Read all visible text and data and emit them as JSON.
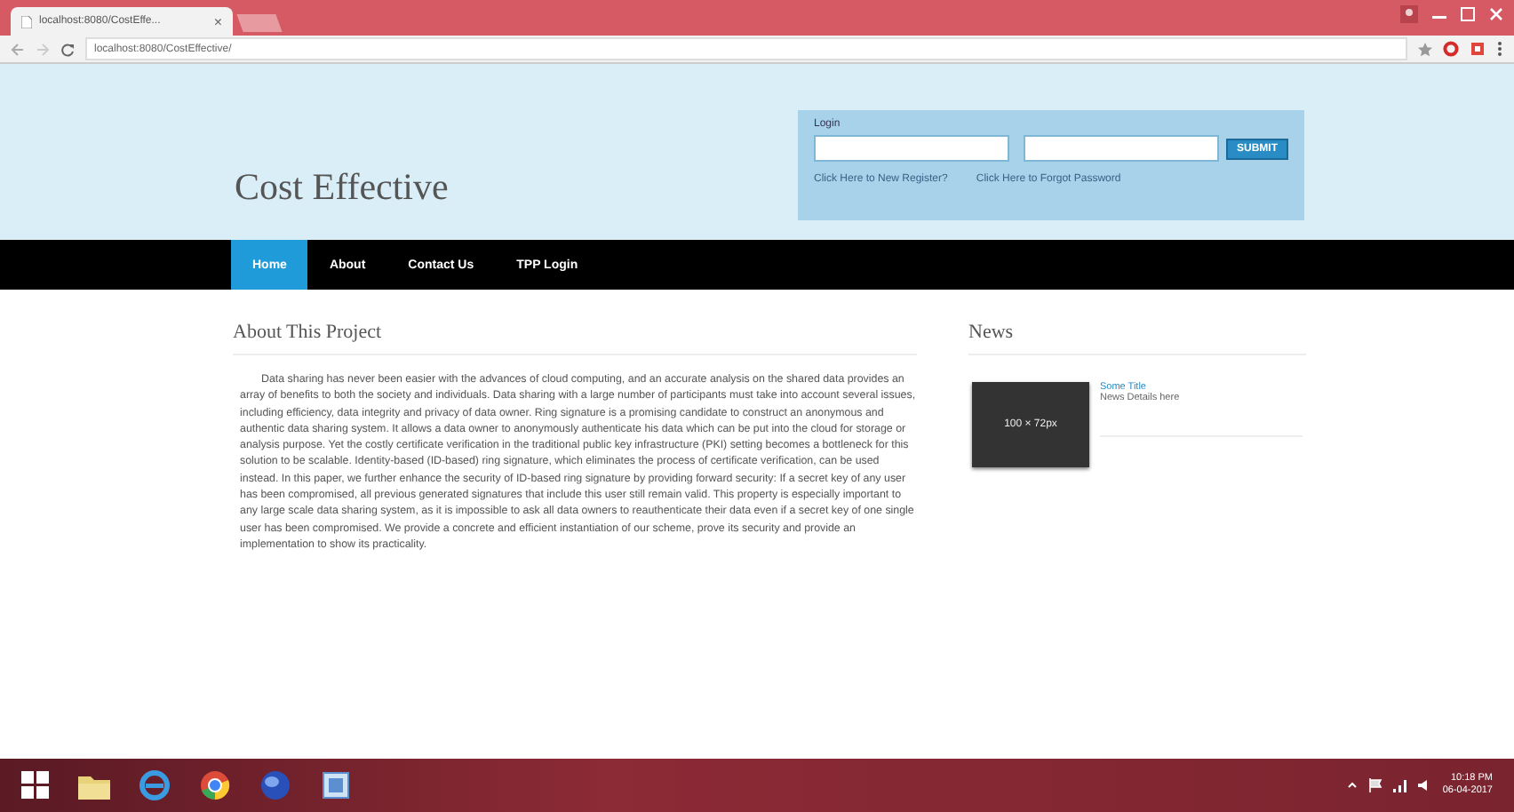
{
  "browser": {
    "tab_title": "localhost:8080/CostEffe...",
    "tab_close": "×",
    "url": "localhost:8080/CostEffective/"
  },
  "site": {
    "title": "Cost Effective"
  },
  "login": {
    "label": "Login",
    "button": "SUBMIT",
    "links": [
      "Click Here to New Register?",
      "Click Here to Forgot Password"
    ]
  },
  "nav": [
    {
      "label": "Home",
      "selected": true
    },
    {
      "label": "About",
      "selected": false
    },
    {
      "label": "Contact Us",
      "selected": false
    },
    {
      "label": "TPP Login",
      "selected": false
    }
  ],
  "about": {
    "heading": "About This Project",
    "text": "Data sharing has never been easier with the advances of cloud computing, and an accurate analysis on the shared data provides an array of benefits to both the society and individuals. Data sharing with a large number of participants must take into account several issues, including efficiency, data integrity and privacy of data owner. Ring signature is a promising candidate to construct an anonymous and authentic data sharing system. It allows a data owner to anonymously authenticate his data which can be put into the cloud for storage or analysis purpose. Yet the costly certificate verification in the traditional public key infrastructure (PKI) setting becomes a bottleneck for this solution to be scalable. Identity-based (ID-based) ring signature, which eliminates the process of certificate verification, can be used instead. In this paper, we further enhance the security of ID-based ring signature by providing forward security: If a secret key of any user has been compromised, all previous generated signatures that include this user still remain valid. This property is especially important to any large scale data sharing system, as it is impossible to ask all data owners to reauthenticate their data even if a secret key of one single user has been compromised. We provide a concrete and efficient instantiation of our scheme, prove its security and provide an implementation to show its practicality."
  },
  "news": {
    "heading": "News",
    "items": [
      {
        "thumbnail": "100 × 72px",
        "title": "Some Title",
        "details": "News Details here"
      }
    ]
  },
  "taskbar": {
    "time": "10:18 PM",
    "date": "06-04-2017"
  }
}
